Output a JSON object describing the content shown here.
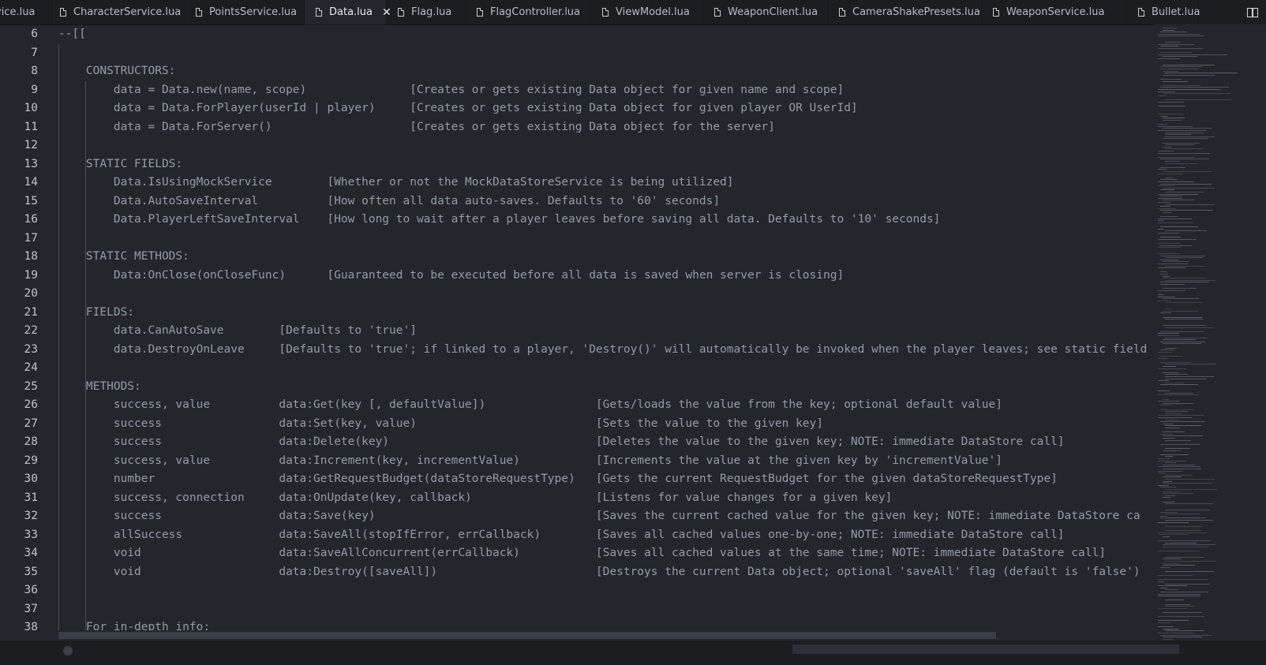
{
  "tabs": [
    {
      "label": "vice.lua",
      "active": false,
      "partial": true
    },
    {
      "label": "CharacterService.lua",
      "active": false
    },
    {
      "label": "PointsService.lua",
      "active": false
    },
    {
      "label": "Data.lua",
      "active": true,
      "close": "✕"
    },
    {
      "label": "Flag.lua",
      "active": false
    },
    {
      "label": "FlagController.lua",
      "active": false
    },
    {
      "label": "ViewModel.lua",
      "active": false
    },
    {
      "label": "WeaponClient.lua",
      "active": false
    },
    {
      "label": "CameraShakePresets.lua",
      "active": false
    },
    {
      "label": "WeaponService.lua",
      "active": false
    },
    {
      "label": "Bullet.lua",
      "active": false
    }
  ],
  "editor": {
    "lines": [
      {
        "n": "6",
        "text": "--[["
      },
      {
        "n": "7",
        "text": ""
      },
      {
        "n": "8",
        "text": "    CONSTRUCTORS:"
      },
      {
        "n": "9",
        "text": "        data = Data.new(name, scope)               [Creates or gets existing Data object for given name and scope]"
      },
      {
        "n": "10",
        "text": "        data = Data.ForPlayer(userId | player)     [Creates or gets existing Data object for given player OR UserId]"
      },
      {
        "n": "11",
        "text": "        data = Data.ForServer()                    [Creates or gets existing Data object for the server]"
      },
      {
        "n": "12",
        "text": ""
      },
      {
        "n": "13",
        "text": "    STATIC FIELDS:"
      },
      {
        "n": "14",
        "text": "        Data.IsUsingMockService        [Whether or not the MockDataStoreService is being utilized]"
      },
      {
        "n": "15",
        "text": "        Data.AutoSaveInterval          [How often all data auto-saves. Defaults to '60' seconds]"
      },
      {
        "n": "16",
        "text": "        Data.PlayerLeftSaveInterval    [How long to wait after a player leaves before saving all data. Defaults to '10' seconds]"
      },
      {
        "n": "17",
        "text": ""
      },
      {
        "n": "18",
        "text": "    STATIC METHODS:"
      },
      {
        "n": "19",
        "text": "        Data:OnClose(onCloseFunc)      [Guaranteed to be executed before all data is saved when server is closing]"
      },
      {
        "n": "20",
        "text": ""
      },
      {
        "n": "21",
        "text": "    FIELDS:"
      },
      {
        "n": "22",
        "text": "        data.CanAutoSave        [Defaults to 'true']"
      },
      {
        "n": "23",
        "text": "        data.DestroyOnLeave     [Defaults to 'true'; if linked to a player, 'Destroy()' will automatically be invoked when the player leaves; see static field"
      },
      {
        "n": "24",
        "text": ""
      },
      {
        "n": "25",
        "text": "    METHODS:"
      },
      {
        "n": "26",
        "text": "        success, value          data:Get(key [, defaultValue])                [Gets/loads the value from the key; optional default value]"
      },
      {
        "n": "27",
        "text": "        success                 data:Set(key, value)                          [Sets the value to the given key]"
      },
      {
        "n": "28",
        "text": "        success                 data:Delete(key)                              [Deletes the value to the given key; NOTE: immediate DataStore call]"
      },
      {
        "n": "29",
        "text": "        success, value          data:Increment(key, incrementValue)           [Increments the value at the given key by 'incrementValue']"
      },
      {
        "n": "30",
        "text": "        number                  data:GetRequestBudget(dataStoreRequestType)   [Gets the current RequestBudget for the given dataStoreRequestType]"
      },
      {
        "n": "31",
        "text": "        success, connection     data:OnUpdate(key, callback)                  [Listens for value changes for a given key]"
      },
      {
        "n": "32",
        "text": "        success                 data:Save(key)                                [Saves the current cached value for the given key; NOTE: immediate DataStore ca"
      },
      {
        "n": "33",
        "text": "        allSuccess              data:SaveAll(stopIfError, errCallback)        [Saves all cached values one-by-one; NOTE: immediate DataStore call]"
      },
      {
        "n": "34",
        "text": "        void                    data:SaveAllConcurrent(errCallback)           [Saves all cached values at the same time; NOTE: immediate DataStore call]"
      },
      {
        "n": "35",
        "text": "        void                    data:Destroy([saveAll])                       [Destroys the current Data object; optional 'saveAll' flag (default is 'false')"
      },
      {
        "n": "36",
        "text": ""
      },
      {
        "n": "37",
        "text": ""
      },
      {
        "n": "38",
        "text": "    For in-depth info:"
      }
    ]
  },
  "icons": {
    "file": "file-icon",
    "close": "close-icon",
    "layout": "split-layout-icon"
  },
  "colors": {
    "background": "#23262b",
    "tabbar": "#1b1d21",
    "comment_text": "#949ca5",
    "line_number": "#bfc5cc"
  }
}
